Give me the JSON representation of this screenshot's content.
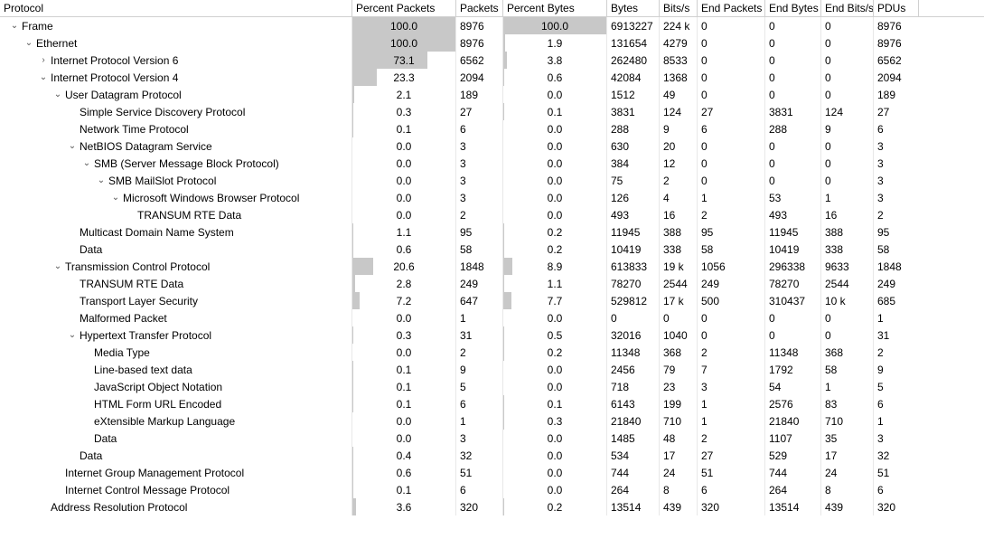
{
  "columns": {
    "protocol": "Protocol",
    "pct_packets": "Percent Packets",
    "packets": "Packets",
    "pct_bytes": "Percent Bytes",
    "bytes": "Bytes",
    "bits_s": "Bits/s",
    "end_packets": "End Packets",
    "end_bytes": "End Bytes",
    "end_bits_s": "End Bits/s",
    "pdus": "PDUs"
  },
  "rows": [
    {
      "indent": 0,
      "exp": "open",
      "name": "Frame",
      "ppkts": "100.0",
      "ppkts_bar": 100,
      "pkts": "8976",
      "pbytes": "100.0",
      "pbytes_bar": 100,
      "bytes": "6913227",
      "bits": "224 k",
      "epkts": "0",
      "ebytes": "0",
      "ebits": "0",
      "pdus": "8976"
    },
    {
      "indent": 1,
      "exp": "open",
      "name": "Ethernet",
      "ppkts": "100.0",
      "ppkts_bar": 100,
      "pkts": "8976",
      "pbytes": "1.9",
      "pbytes_bar": 1.9,
      "bytes": "131654",
      "bits": "4279",
      "epkts": "0",
      "ebytes": "0",
      "ebits": "0",
      "pdus": "8976"
    },
    {
      "indent": 2,
      "exp": "closed",
      "name": "Internet Protocol Version 6",
      "ppkts": "73.1",
      "ppkts_bar": 73.1,
      "pkts": "6562",
      "pbytes": "3.8",
      "pbytes_bar": 3.8,
      "bytes": "262480",
      "bits": "8533",
      "epkts": "0",
      "ebytes": "0",
      "ebits": "0",
      "pdus": "6562"
    },
    {
      "indent": 2,
      "exp": "open",
      "name": "Internet Protocol Version 4",
      "ppkts": "23.3",
      "ppkts_bar": 23.3,
      "pkts": "2094",
      "pbytes": "0.6",
      "pbytes_bar": 0.6,
      "bytes": "42084",
      "bits": "1368",
      "epkts": "0",
      "ebytes": "0",
      "ebits": "0",
      "pdus": "2094"
    },
    {
      "indent": 3,
      "exp": "open",
      "name": "User Datagram Protocol",
      "ppkts": "2.1",
      "ppkts_bar": 2.1,
      "pkts": "189",
      "pbytes": "0.0",
      "pbytes_bar": 0,
      "bytes": "1512",
      "bits": "49",
      "epkts": "0",
      "ebytes": "0",
      "ebits": "0",
      "pdus": "189"
    },
    {
      "indent": 4,
      "exp": "none",
      "name": "Simple Service Discovery Protocol",
      "ppkts": "0.3",
      "ppkts_bar": 0.3,
      "pkts": "27",
      "pbytes": "0.1",
      "pbytes_bar": 0.1,
      "bytes": "3831",
      "bits": "124",
      "epkts": "27",
      "ebytes": "3831",
      "ebits": "124",
      "pdus": "27"
    },
    {
      "indent": 4,
      "exp": "none",
      "name": "Network Time Protocol",
      "ppkts": "0.1",
      "ppkts_bar": 0.1,
      "pkts": "6",
      "pbytes": "0.0",
      "pbytes_bar": 0,
      "bytes": "288",
      "bits": "9",
      "epkts": "6",
      "ebytes": "288",
      "ebits": "9",
      "pdus": "6"
    },
    {
      "indent": 4,
      "exp": "open",
      "name": "NetBIOS Datagram Service",
      "ppkts": "0.0",
      "ppkts_bar": 0,
      "pkts": "3",
      "pbytes": "0.0",
      "pbytes_bar": 0,
      "bytes": "630",
      "bits": "20",
      "epkts": "0",
      "ebytes": "0",
      "ebits": "0",
      "pdus": "3"
    },
    {
      "indent": 5,
      "exp": "open",
      "name": "SMB (Server Message Block Protocol)",
      "ppkts": "0.0",
      "ppkts_bar": 0,
      "pkts": "3",
      "pbytes": "0.0",
      "pbytes_bar": 0,
      "bytes": "384",
      "bits": "12",
      "epkts": "0",
      "ebytes": "0",
      "ebits": "0",
      "pdus": "3"
    },
    {
      "indent": 6,
      "exp": "open",
      "name": "SMB MailSlot Protocol",
      "ppkts": "0.0",
      "ppkts_bar": 0,
      "pkts": "3",
      "pbytes": "0.0",
      "pbytes_bar": 0,
      "bytes": "75",
      "bits": "2",
      "epkts": "0",
      "ebytes": "0",
      "ebits": "0",
      "pdus": "3"
    },
    {
      "indent": 7,
      "exp": "open",
      "name": "Microsoft Windows Browser Protocol",
      "ppkts": "0.0",
      "ppkts_bar": 0,
      "pkts": "3",
      "pbytes": "0.0",
      "pbytes_bar": 0,
      "bytes": "126",
      "bits": "4",
      "epkts": "1",
      "ebytes": "53",
      "ebits": "1",
      "pdus": "3"
    },
    {
      "indent": 8,
      "exp": "none",
      "name": "TRANSUM RTE Data",
      "ppkts": "0.0",
      "ppkts_bar": 0,
      "pkts": "2",
      "pbytes": "0.0",
      "pbytes_bar": 0,
      "bytes": "493",
      "bits": "16",
      "epkts": "2",
      "ebytes": "493",
      "ebits": "16",
      "pdus": "2"
    },
    {
      "indent": 4,
      "exp": "none",
      "name": "Multicast Domain Name System",
      "ppkts": "1.1",
      "ppkts_bar": 1.1,
      "pkts": "95",
      "pbytes": "0.2",
      "pbytes_bar": 0.2,
      "bytes": "11945",
      "bits": "388",
      "epkts": "95",
      "ebytes": "11945",
      "ebits": "388",
      "pdus": "95"
    },
    {
      "indent": 4,
      "exp": "none",
      "name": "Data",
      "ppkts": "0.6",
      "ppkts_bar": 0.6,
      "pkts": "58",
      "pbytes": "0.2",
      "pbytes_bar": 0.2,
      "bytes": "10419",
      "bits": "338",
      "epkts": "58",
      "ebytes": "10419",
      "ebits": "338",
      "pdus": "58"
    },
    {
      "indent": 3,
      "exp": "open",
      "name": "Transmission Control Protocol",
      "ppkts": "20.6",
      "ppkts_bar": 20.6,
      "pkts": "1848",
      "pbytes": "8.9",
      "pbytes_bar": 8.9,
      "bytes": "613833",
      "bits": "19 k",
      "epkts": "1056",
      "ebytes": "296338",
      "ebits": "9633",
      "pdus": "1848"
    },
    {
      "indent": 4,
      "exp": "none",
      "name": "TRANSUM RTE Data",
      "ppkts": "2.8",
      "ppkts_bar": 2.8,
      "pkts": "249",
      "pbytes": "1.1",
      "pbytes_bar": 1.1,
      "bytes": "78270",
      "bits": "2544",
      "epkts": "249",
      "ebytes": "78270",
      "ebits": "2544",
      "pdus": "249"
    },
    {
      "indent": 4,
      "exp": "none",
      "name": "Transport Layer Security",
      "ppkts": "7.2",
      "ppkts_bar": 7.2,
      "pkts": "647",
      "pbytes": "7.7",
      "pbytes_bar": 7.7,
      "bytes": "529812",
      "bits": "17 k",
      "epkts": "500",
      "ebytes": "310437",
      "ebits": "10 k",
      "pdus": "685"
    },
    {
      "indent": 4,
      "exp": "none",
      "name": "Malformed Packet",
      "ppkts": "0.0",
      "ppkts_bar": 0,
      "pkts": "1",
      "pbytes": "0.0",
      "pbytes_bar": 0,
      "bytes": "0",
      "bits": "0",
      "epkts": "0",
      "ebytes": "0",
      "ebits": "0",
      "pdus": "1"
    },
    {
      "indent": 4,
      "exp": "open",
      "name": "Hypertext Transfer Protocol",
      "ppkts": "0.3",
      "ppkts_bar": 0.3,
      "pkts": "31",
      "pbytes": "0.5",
      "pbytes_bar": 0.5,
      "bytes": "32016",
      "bits": "1040",
      "epkts": "0",
      "ebytes": "0",
      "ebits": "0",
      "pdus": "31"
    },
    {
      "indent": 5,
      "exp": "none",
      "name": "Media Type",
      "ppkts": "0.0",
      "ppkts_bar": 0,
      "pkts": "2",
      "pbytes": "0.2",
      "pbytes_bar": 0.2,
      "bytes": "11348",
      "bits": "368",
      "epkts": "2",
      "ebytes": "11348",
      "ebits": "368",
      "pdus": "2"
    },
    {
      "indent": 5,
      "exp": "none",
      "name": "Line-based text data",
      "ppkts": "0.1",
      "ppkts_bar": 0.1,
      "pkts": "9",
      "pbytes": "0.0",
      "pbytes_bar": 0,
      "bytes": "2456",
      "bits": "79",
      "epkts": "7",
      "ebytes": "1792",
      "ebits": "58",
      "pdus": "9"
    },
    {
      "indent": 5,
      "exp": "none",
      "name": "JavaScript Object Notation",
      "ppkts": "0.1",
      "ppkts_bar": 0.1,
      "pkts": "5",
      "pbytes": "0.0",
      "pbytes_bar": 0,
      "bytes": "718",
      "bits": "23",
      "epkts": "3",
      "ebytes": "54",
      "ebits": "1",
      "pdus": "5"
    },
    {
      "indent": 5,
      "exp": "none",
      "name": "HTML Form URL Encoded",
      "ppkts": "0.1",
      "ppkts_bar": 0.1,
      "pkts": "6",
      "pbytes": "0.1",
      "pbytes_bar": 0.1,
      "bytes": "6143",
      "bits": "199",
      "epkts": "1",
      "ebytes": "2576",
      "ebits": "83",
      "pdus": "6"
    },
    {
      "indent": 5,
      "exp": "none",
      "name": "eXtensible Markup Language",
      "ppkts": "0.0",
      "ppkts_bar": 0,
      "pkts": "1",
      "pbytes": "0.3",
      "pbytes_bar": 0.3,
      "bytes": "21840",
      "bits": "710",
      "epkts": "1",
      "ebytes": "21840",
      "ebits": "710",
      "pdus": "1"
    },
    {
      "indent": 5,
      "exp": "none",
      "name": "Data",
      "ppkts": "0.0",
      "ppkts_bar": 0,
      "pkts": "3",
      "pbytes": "0.0",
      "pbytes_bar": 0,
      "bytes": "1485",
      "bits": "48",
      "epkts": "2",
      "ebytes": "1107",
      "ebits": "35",
      "pdus": "3"
    },
    {
      "indent": 4,
      "exp": "none",
      "name": "Data",
      "ppkts": "0.4",
      "ppkts_bar": 0.4,
      "pkts": "32",
      "pbytes": "0.0",
      "pbytes_bar": 0,
      "bytes": "534",
      "bits": "17",
      "epkts": "27",
      "ebytes": "529",
      "ebits": "17",
      "pdus": "32"
    },
    {
      "indent": 3,
      "exp": "none",
      "name": "Internet Group Management Protocol",
      "ppkts": "0.6",
      "ppkts_bar": 0.6,
      "pkts": "51",
      "pbytes": "0.0",
      "pbytes_bar": 0,
      "bytes": "744",
      "bits": "24",
      "epkts": "51",
      "ebytes": "744",
      "ebits": "24",
      "pdus": "51"
    },
    {
      "indent": 3,
      "exp": "none",
      "name": "Internet Control Message Protocol",
      "ppkts": "0.1",
      "ppkts_bar": 0.1,
      "pkts": "6",
      "pbytes": "0.0",
      "pbytes_bar": 0,
      "bytes": "264",
      "bits": "8",
      "epkts": "6",
      "ebytes": "264",
      "ebits": "8",
      "pdus": "6"
    },
    {
      "indent": 2,
      "exp": "none",
      "name": "Address Resolution Protocol",
      "ppkts": "3.6",
      "ppkts_bar": 3.6,
      "pkts": "320",
      "pbytes": "0.2",
      "pbytes_bar": 0.2,
      "bytes": "13514",
      "bits": "439",
      "epkts": "320",
      "ebytes": "13514",
      "ebits": "439",
      "pdus": "320"
    }
  ]
}
